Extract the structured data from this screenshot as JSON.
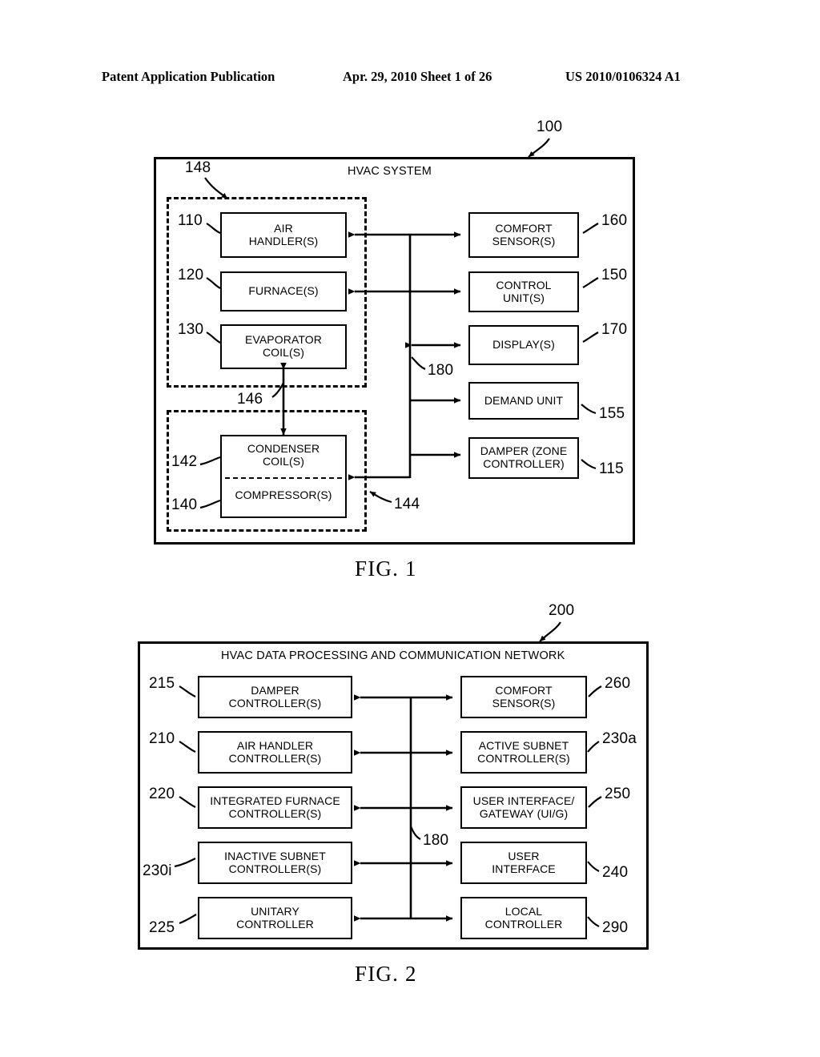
{
  "header": {
    "left": "Patent Application Publication",
    "middle": "Apr. 29, 2010  Sheet 1 of 26",
    "right": "US 2010/0106324 A1"
  },
  "figure1": {
    "caption": "FIG. 1",
    "system_label": "HVAC SYSTEM",
    "figure_ref": "100",
    "indoor_group_ref": "148",
    "outdoor_link_ref": "146",
    "bus_ref": "180",
    "outdoor_arrow_ref": "144",
    "left_nodes": [
      {
        "ref": "110",
        "lines": [
          "AIR",
          "HANDLER(S)"
        ]
      },
      {
        "ref": "120",
        "lines": [
          "FURNACE(S)"
        ]
      },
      {
        "ref": "130",
        "lines": [
          "EVAPORATOR",
          "COIL(S)"
        ]
      }
    ],
    "split_node": {
      "upper_ref": "142",
      "upper_lines": [
        "CONDENSER",
        "COIL(S)"
      ],
      "lower_ref": "140",
      "lower_lines": [
        "COMPRESSOR(S)"
      ]
    },
    "right_nodes": [
      {
        "ref": "160",
        "lines": [
          "COMFORT",
          "SENSOR(S)"
        ]
      },
      {
        "ref": "150",
        "lines": [
          "CONTROL",
          "UNIT(S)"
        ]
      },
      {
        "ref": "170",
        "lines": [
          "DISPLAY(S)"
        ]
      },
      {
        "ref": "155",
        "lines": [
          "DEMAND UNIT"
        ]
      },
      {
        "ref": "115",
        "lines": [
          "DAMPER (ZONE",
          "CONTROLLER)"
        ]
      }
    ]
  },
  "figure2": {
    "caption": "FIG. 2",
    "system_label": "HVAC DATA PROCESSING AND COMMUNICATION NETWORK",
    "figure_ref": "200",
    "bus_ref": "180",
    "left_nodes": [
      {
        "ref": "215",
        "lines": [
          "DAMPER",
          "CONTROLLER(S)"
        ]
      },
      {
        "ref": "210",
        "lines": [
          "AIR HANDLER",
          "CONTROLLER(S)"
        ]
      },
      {
        "ref": "220",
        "lines": [
          "INTEGRATED FURNACE",
          "CONTROLLER(S)"
        ]
      },
      {
        "ref": "230i",
        "lines": [
          "INACTIVE SUBNET",
          "CONTROLLER(S)"
        ]
      },
      {
        "ref": "225",
        "lines": [
          "UNITARY",
          "CONTROLLER"
        ]
      }
    ],
    "right_nodes": [
      {
        "ref": "260",
        "lines": [
          "COMFORT",
          "SENSOR(S)"
        ]
      },
      {
        "ref": "230a",
        "lines": [
          "ACTIVE SUBNET",
          "CONTROLLER(S)"
        ]
      },
      {
        "ref": "250",
        "lines": [
          "USER INTERFACE/",
          "GATEWAY (UI/G)"
        ]
      },
      {
        "ref": "240",
        "lines": [
          "USER",
          "INTERFACE"
        ]
      },
      {
        "ref": "290",
        "lines": [
          "LOCAL",
          "CONTROLLER"
        ]
      }
    ]
  }
}
